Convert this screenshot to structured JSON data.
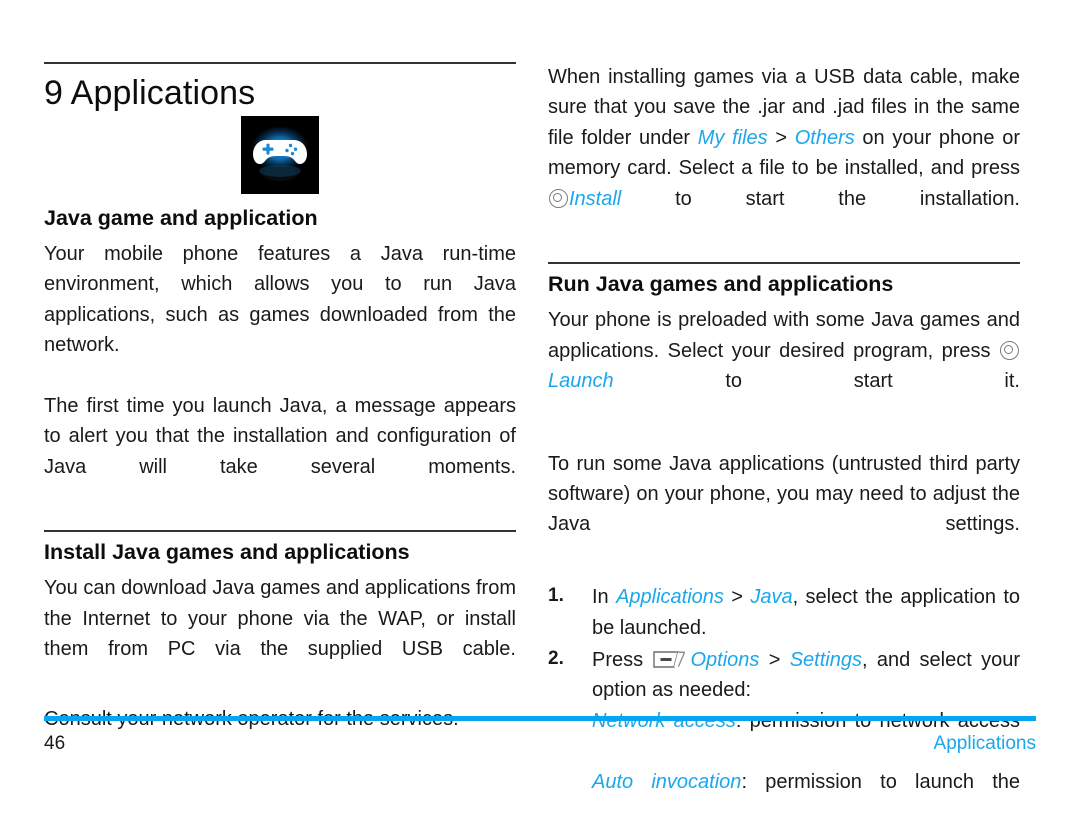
{
  "colors": {
    "accent_blue": "#1aa7ec",
    "footer_rule_blue": "#05a5f0",
    "rule_dark": "#333333",
    "text": "#1a1a1a"
  },
  "chapter": {
    "title": "9 Applications",
    "icon_name": "gamepad-icon"
  },
  "left_column": {
    "section1": {
      "heading": "Java game and application",
      "paragraph1": "Your mobile phone features a Java run-time environment, which allows you to run Java applications, such as games downloaded from the network.",
      "paragraph2": "The first time you launch Java, a message appears to alert you that the installation and configuration of Java will take several moments."
    },
    "section2": {
      "heading": "Install Java games and applications",
      "paragraph1": "You can download Java games and applications from the Internet to your phone via the WAP, or install them from PC via the supplied USB cable.",
      "paragraph2": "Consult your network operator for the services."
    }
  },
  "right_column": {
    "intro": {
      "part1": "When installing games via a USB data cable, make sure that you save the .jar and .jad files in the same file folder under ",
      "link_my_files": "My files",
      "separator1": " > ",
      "link_others": "Others",
      "part2": " on your phone or memory card. Select a file to be installed, and press ",
      "key_install_icon": "ok-key-icon",
      "link_install": "Install",
      "part3": " to start the installation."
    },
    "section3": {
      "heading": "Run Java games and applications",
      "part1": "Your phone is preloaded with some Java games and applications. Select your desired program, press ",
      "key_launch_icon": "ok-key-icon",
      "link_launch": "Launch",
      "part2": " to start it."
    },
    "paragraph_untrusted": "To run some Java applications (untrusted third party software) on your phone, you may need to adjust the Java settings.",
    "steps": [
      {
        "number": "1.",
        "part1": "In ",
        "link1": "Applications",
        "separator": " > ",
        "link2": "Java",
        "part2": ", select the application to be launched."
      },
      {
        "number": "2.",
        "part1": "Press ",
        "key_icon": "left-soft-key-icon",
        "link1": "Options",
        "separator": " > ",
        "link2": "Settings",
        "part2": ", and select your option as needed:",
        "sub_items": [
          {
            "term": "Network access",
            "desc": ": permission to network access"
          },
          {
            "term": "Auto invocation",
            "desc": ": permission to launch the"
          }
        ]
      }
    ]
  },
  "footer": {
    "page_number": "46",
    "section_label": "Applications"
  }
}
